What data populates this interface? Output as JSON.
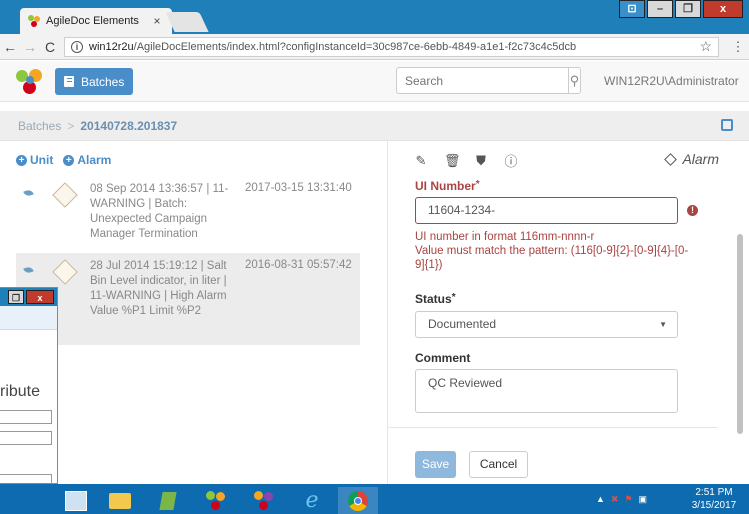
{
  "browser": {
    "tab_title": "AgileDoc Elements",
    "tab_close": "×",
    "url_host": "win12r2u",
    "url_path": "/AgileDocElements/index.html?configInstanceId=30c987ce-6ebb-4849-a1e1-f2c73c4c5dcb",
    "window_buttons": {
      "user": "⊡",
      "minimize": "–",
      "restore": "❐",
      "close": "x"
    }
  },
  "navbar": {
    "batches_label": "Batches",
    "search_placeholder": "Search",
    "user": "WIN12R2U\\Administrator"
  },
  "breadcrumb": {
    "root": "Batches",
    "separator": ">",
    "current": "20140728.201837"
  },
  "left_panel": {
    "actions": [
      {
        "label": "Unit"
      },
      {
        "label": "Alarm"
      }
    ],
    "alarms": [
      {
        "description": "08 Sep 2014 13:36:57 | 11-WARNING | Batch: Unexpected Campaign Manager Termination",
        "time": "2017-03-15 13:31:40",
        "selected": false
      },
      {
        "description": "28 Jul 2014 15:19:12 | Salt Bin Level indicator, in liter | 11-WARNING | High Alarm Value %P1 Limit %P2",
        "time": "2016-08-31 05:57:42",
        "selected": true
      }
    ]
  },
  "detail": {
    "type_label": "Alarm",
    "ui_number": {
      "label": "UI Number",
      "required": "*",
      "value": "11604-1234-",
      "error_line1": "UI number in format 116mm-nnnn-r",
      "error_line2": "Value must match the pattern: (116[0-9]{2}-[0-9]{4}-[0-9]{1})",
      "error_icon": "!"
    },
    "status": {
      "label": "Status",
      "required": "*",
      "value": "Documented"
    },
    "comment": {
      "label": "Comment",
      "value": "QC Reviewed"
    },
    "save_label": "Save",
    "cancel_label": "Cancel"
  },
  "background_window": {
    "text": "ribute"
  },
  "taskbar": {
    "time": "2:51 PM",
    "date": "3/15/2017"
  },
  "colors": {
    "primary": "#4a8ec9",
    "error": "#a94442",
    "taskbar": "#0f6bb0",
    "titlebar": "#1e7fb9"
  }
}
